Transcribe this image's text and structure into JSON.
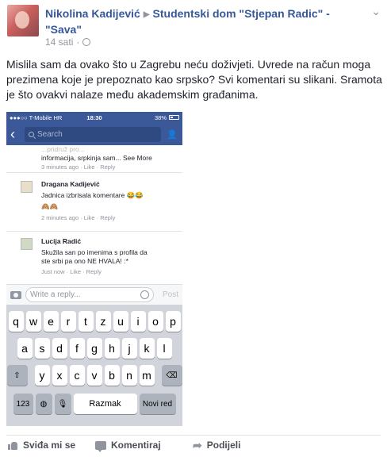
{
  "post": {
    "author": "Nikolina Kadijević",
    "target": "Studentski dom \"Stjepan Radic\" - \"Sava\"",
    "timestamp": "14 sati",
    "text": "Mislila sam da ovako što u Zagrebu neću doživjeti. Uvrede na račun moga prezimena koje je prepoznato kao srpsko? Svi komentari su slikani. Sramota je što ovakvi nalaze među akademskim građanima."
  },
  "screenshot": {
    "status": {
      "carrier": "●●●○○ T-Mobile HR",
      "time": "18:30",
      "battery": "38%"
    },
    "search_placeholder": "Search",
    "comments": [
      {
        "name": "",
        "text_lines": [
          "...pridruž pro...",
          "informacija, srpkinja sam... See More"
        ],
        "meta": "3 minutes ago · Like · Reply"
      },
      {
        "name": "Dragana Kadijević",
        "text_lines": [
          "Jadnica izbrisala komentare 😂😂",
          "🙈🙈"
        ],
        "meta": "2 minutes ago · Like · Reply"
      },
      {
        "name": "Lucija Radić",
        "text_lines": [
          "Skužila san po imenima s profila da",
          "ste srbi pa ono NE HVALA! :*"
        ],
        "meta": "Just now · Like · Reply"
      }
    ],
    "reply_placeholder": "Write a reply...",
    "post_button": "Post",
    "keyboard": {
      "row1": [
        "q",
        "w",
        "e",
        "r",
        "t",
        "z",
        "u",
        "i",
        "o",
        "p"
      ],
      "row2": [
        "a",
        "s",
        "d",
        "f",
        "g",
        "h",
        "j",
        "k",
        "l"
      ],
      "row3": [
        "y",
        "x",
        "c",
        "v",
        "b",
        "n",
        "m"
      ],
      "numbers": "123",
      "space": "Razmak",
      "return": "Novi red"
    }
  },
  "actions": {
    "like": "Sviđa mi se",
    "comment": "Komentiraj",
    "share": "Podijeli"
  }
}
